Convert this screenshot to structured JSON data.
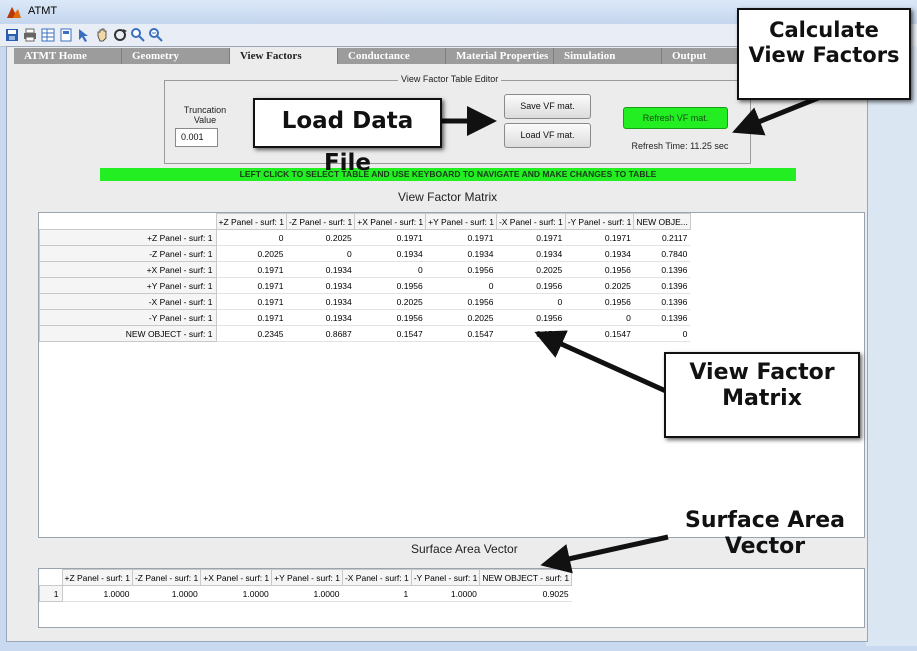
{
  "window": {
    "title": "ATMT"
  },
  "toolbar": {
    "icons": [
      "save-icon",
      "print-icon",
      "data-icon",
      "doc-icon",
      "pointer-icon",
      "pan-icon",
      "rotate-icon",
      "zoom-in-icon",
      "zoom-out-icon"
    ]
  },
  "tabs": [
    {
      "label": "ATMT Home"
    },
    {
      "label": "Geometry"
    },
    {
      "label": "View Factors"
    },
    {
      "label": "Conductance"
    },
    {
      "label": "Material Properties"
    },
    {
      "label": "Simulation"
    },
    {
      "label": "Output"
    }
  ],
  "editor": {
    "title": "View Factor Table Editor",
    "truncation_label_1": "Truncation",
    "truncation_label_2": "Value",
    "truncation_value": "0.001",
    "save_label": "Save VF mat.",
    "load_label": "Load VF mat.",
    "refresh_label": "Refresh VF mat.",
    "refresh_time": "Refresh Time: 11.25 sec"
  },
  "instruction": "LEFT CLICK TO SELECT TABLE AND USE KEYBOARD TO NAVIGATE AND MAKE CHANGES TO TABLE",
  "vf_matrix": {
    "title": "View Factor Matrix",
    "columns": [
      "+Z Panel - surf: 1",
      "-Z Panel - surf: 1",
      "+X Panel - surf: 1",
      "+Y Panel - surf: 1",
      "-X Panel - surf: 1",
      "-Y Panel - surf: 1",
      "NEW OBJE..."
    ],
    "rows": [
      {
        "label": "+Z Panel - surf: 1",
        "values": [
          "0",
          "0.2025",
          "0.1971",
          "0.1971",
          "0.1971",
          "0.1971",
          "0.2117"
        ]
      },
      {
        "label": "-Z Panel - surf: 1",
        "values": [
          "0.2025",
          "0",
          "0.1934",
          "0.1934",
          "0.1934",
          "0.1934",
          "0.7840"
        ]
      },
      {
        "label": "+X Panel - surf: 1",
        "values": [
          "0.1971",
          "0.1934",
          "0",
          "0.1956",
          "0.2025",
          "0.1956",
          "0.1396"
        ]
      },
      {
        "label": "+Y Panel - surf: 1",
        "values": [
          "0.1971",
          "0.1934",
          "0.1956",
          "0",
          "0.1956",
          "0.2025",
          "0.1396"
        ]
      },
      {
        "label": "-X Panel - surf: 1",
        "values": [
          "0.1971",
          "0.1934",
          "0.2025",
          "0.1956",
          "0",
          "0.1956",
          "0.1396"
        ]
      },
      {
        "label": "-Y Panel - surf: 1",
        "values": [
          "0.1971",
          "0.1934",
          "0.1956",
          "0.2025",
          "0.1956",
          "0",
          "0.1396"
        ]
      },
      {
        "label": "NEW OBJECT - surf: 1",
        "values": [
          "0.2345",
          "0.8687",
          "0.1547",
          "0.1547",
          "0.1547",
          "0.1547",
          "0"
        ]
      }
    ]
  },
  "area_vector": {
    "title": "Surface Area Vector",
    "columns": [
      "+Z Panel - surf: 1",
      "-Z Panel - surf: 1",
      "+X Panel - surf: 1",
      "+Y Panel - surf: 1",
      "-X Panel - surf: 1",
      "-Y Panel - surf: 1",
      "NEW OBJECT - surf: 1"
    ],
    "rows": [
      {
        "label": "1",
        "values": [
          "1.0000",
          "1.0000",
          "1.0000",
          "1.0000",
          "1",
          "1.0000",
          "0.9025"
        ]
      }
    ]
  },
  "callouts": {
    "calc_line1": "Calculate",
    "calc_line2": "View Factors",
    "load": "Load Data File",
    "vf_line1": "View Factor",
    "vf_line2": "Matrix",
    "sa_line1": "Surface Area",
    "sa_line2": "Vector"
  },
  "colors": {
    "instruction_bar": "#22ee22",
    "refresh_button": "#22ee22",
    "window_frame": "#c9daf0"
  }
}
